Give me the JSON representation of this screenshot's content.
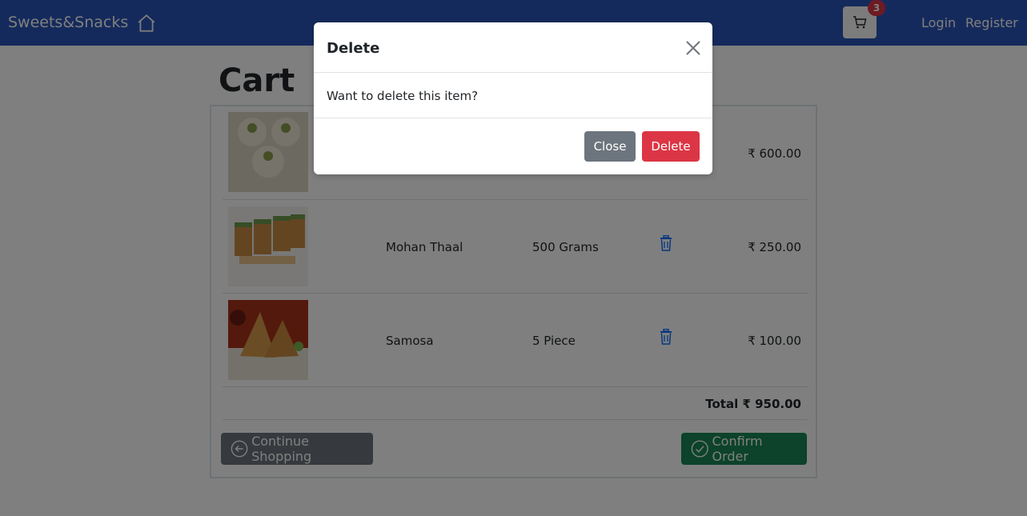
{
  "navbar": {
    "brand": "Sweets&Snacks",
    "home_icon": "home-icon",
    "cart_icon": "cart-icon",
    "cart_count": "3",
    "login": "Login",
    "register": "Register"
  },
  "page": {
    "title": "Cart"
  },
  "cart": {
    "items": [
      {
        "name": "",
        "qty": "",
        "price": "₹ 600.00"
      },
      {
        "name": "Mohan Thaal",
        "qty": "500 Grams",
        "price": "₹ 250.00"
      },
      {
        "name": "Samosa",
        "qty": "5 Piece",
        "price": "₹ 100.00"
      }
    ],
    "total": "Total ₹ 950.00",
    "continue_label": "Continue Shopping",
    "confirm_label": "Confirm Order"
  },
  "modal": {
    "title": "Delete",
    "body": "Want to delete this item?",
    "close_label": "Close",
    "delete_label": "Delete"
  },
  "colors": {
    "navbar": "#2a55b8",
    "danger": "#dc3545",
    "secondary": "#6c757d",
    "success": "#198754",
    "primary": "#0d6efd"
  }
}
